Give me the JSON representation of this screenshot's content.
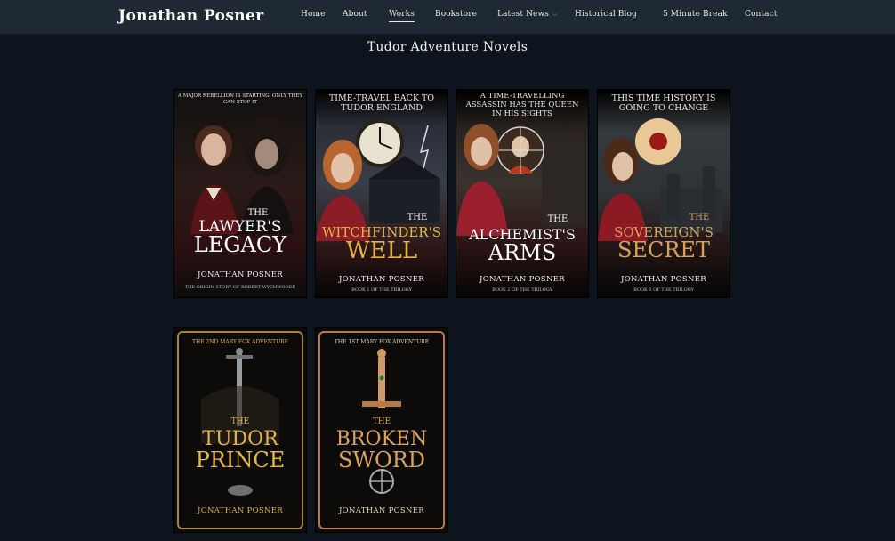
{
  "header": {
    "brand": "Jonathan Posner",
    "nav": [
      {
        "label": "Home"
      },
      {
        "label": "About"
      },
      {
        "label": "Works"
      },
      {
        "label": "Bookstore"
      },
      {
        "label": "Latest News"
      },
      {
        "label": "Historical Blog"
      },
      {
        "label": "5 Minute Break"
      },
      {
        "label": "Contact"
      }
    ],
    "active_item": "Works",
    "dropdown_icon": "chevron-down-icon"
  },
  "page": {
    "title": "Tudor Adventure Novels"
  },
  "books": [
    {
      "tagline": "A major rebellion is starting, only they can stop it",
      "title_small": "The",
      "title_line1": "Lawyer's",
      "title_line2": "Legacy",
      "author": "Jonathan Posner",
      "subline": "The origin story of Robert Wychwoode"
    },
    {
      "tagline": "Time-travel back to Tudor England",
      "title_small": "The",
      "title_line1": "Witchfinder's",
      "title_line2": "Well",
      "author": "Jonathan Posner",
      "subline": "Book 1 of the trilogy"
    },
    {
      "tagline": "A time-travelling assassin has the queen in his sights",
      "title_small": "The",
      "title_line1": "Alchemist's",
      "title_line2": "Arms",
      "author": "Jonathan Posner",
      "subline": "Book 2 of the trilogy"
    },
    {
      "tagline": "This time history is going to change",
      "title_small": "The",
      "title_line1": "Sovereign's",
      "title_line2": "Secret",
      "author": "Jonathan Posner",
      "subline": "Book 3 of the trilogy"
    },
    {
      "tagline": "The 2nd Mary Fox Adventure",
      "title_small": "The",
      "title_line1": "Tudor",
      "title_line2": "Prince",
      "author": "Jonathan Posner"
    },
    {
      "tagline": "The 1st Mary Fox Adventure",
      "title_small": "The",
      "title_line1": "Broken",
      "title_line2": "Sword",
      "author": "Jonathan Posner"
    }
  ],
  "colors": {
    "background": "#0d141d",
    "nav_bar": "#1f2933",
    "gold": "#e3b542",
    "copper": "#d9a25a"
  }
}
